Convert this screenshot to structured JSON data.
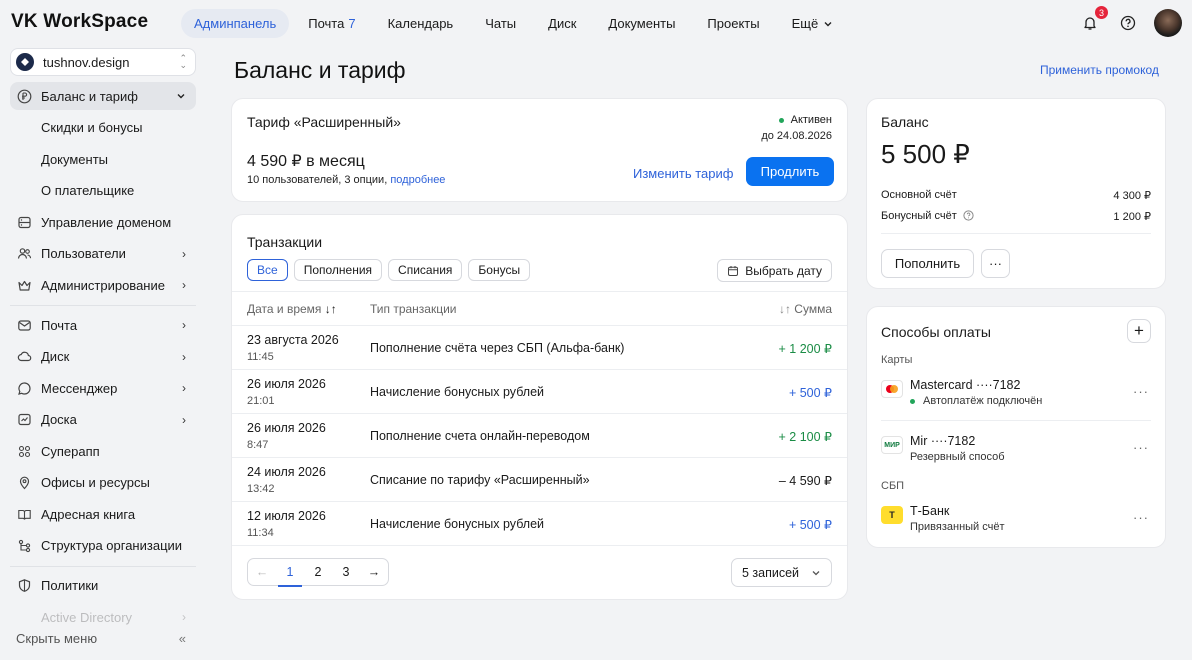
{
  "topbar": {
    "logo": "VK WorkSpace",
    "nav": [
      {
        "label": "Админпанель",
        "active": true
      },
      {
        "label": "Почта",
        "count": "7"
      },
      {
        "label": "Календарь"
      },
      {
        "label": "Чаты"
      },
      {
        "label": "Диск"
      },
      {
        "label": "Документы"
      },
      {
        "label": "Проекты"
      },
      {
        "label": "Ещё"
      }
    ],
    "notifications_count": "3"
  },
  "sidebar": {
    "org": "tushnov.design",
    "items": [
      {
        "label": "Баланс и тариф"
      },
      {
        "label": "Скидки и бонусы"
      },
      {
        "label": "Документы"
      },
      {
        "label": "О плательщике"
      },
      {
        "label": "Управление доменом"
      },
      {
        "label": "Пользователи"
      },
      {
        "label": "Администрирование"
      },
      {
        "label": "Почта"
      },
      {
        "label": "Диск"
      },
      {
        "label": "Мессенджер"
      },
      {
        "label": "Доска"
      },
      {
        "label": "Суперапп"
      },
      {
        "label": "Офисы и ресурсы"
      },
      {
        "label": "Адресная книга"
      },
      {
        "label": "Структура организации"
      },
      {
        "label": "Политики"
      },
      {
        "label": "Active Directory"
      }
    ],
    "hide_menu": "Скрыть меню"
  },
  "page": {
    "title": "Баланс и тариф",
    "promo_link": "Применить промокод"
  },
  "tariff": {
    "title": "Тариф «Расширенный»",
    "status": "Активен",
    "until": "до 24.08.2026",
    "price": "4 590 ₽ в месяц",
    "desc": "10 пользователей, 3 опции,",
    "more_link": "подробнее",
    "change_label": "Изменить тариф",
    "extend_label": "Продлить"
  },
  "transactions": {
    "title": "Транзакции",
    "filters": [
      "Все",
      "Пополнения",
      "Списания",
      "Бонусы"
    ],
    "date_button": "Выбрать дату",
    "columns": {
      "date": "Дата и время",
      "type": "Тип транзакции",
      "amount": "Сумма"
    },
    "rows": [
      {
        "date": "23 августа 2026",
        "time": "11:45",
        "type": "Пополнение счёта через СБП (Альфа-банк)",
        "amount": "+ 1 200 ₽",
        "kind": "green"
      },
      {
        "date": "26 июля 2026",
        "time": "21:01",
        "type": "Начисление бонусных рублей",
        "amount": "+ 500 ₽",
        "kind": "blue"
      },
      {
        "date": "26 июля 2026",
        "time": "8:47",
        "type": "Пополнение счета онлайн-переводом",
        "amount": "+ 2 100 ₽",
        "kind": "green"
      },
      {
        "date": "24 июля 2026",
        "time": "13:42",
        "type": "Списание по тарифу «Расширенный»",
        "amount": "– 4 590 ₽",
        "kind": "dark"
      },
      {
        "date": "12 июля 2026",
        "time": "11:34",
        "type": "Начисление бонусных рублей",
        "amount": "+ 500 ₽",
        "kind": "blue"
      }
    ],
    "pages": [
      "1",
      "2",
      "3"
    ],
    "per_page": "5 записей"
  },
  "balance": {
    "title": "Баланс",
    "amount": "5 500 ₽",
    "main_label": "Основной счёт",
    "main_value": "4 300 ₽",
    "bonus_label": "Бонусный счёт",
    "bonus_value": "1 200 ₽",
    "topup_label": "Пополнить"
  },
  "payment": {
    "title": "Способы оплаты",
    "cards_label": "Карты",
    "sbp_label": "СБП",
    "methods": [
      {
        "name": "Mastercard ····7182",
        "sub": "Автоплатёж подключён"
      },
      {
        "name": "Mir ····7182",
        "sub": "Резервный способ",
        "icon_text": "МИР"
      },
      {
        "name": "Т-Банк",
        "sub": "Привязанный счёт",
        "icon_text": "T"
      }
    ]
  }
}
